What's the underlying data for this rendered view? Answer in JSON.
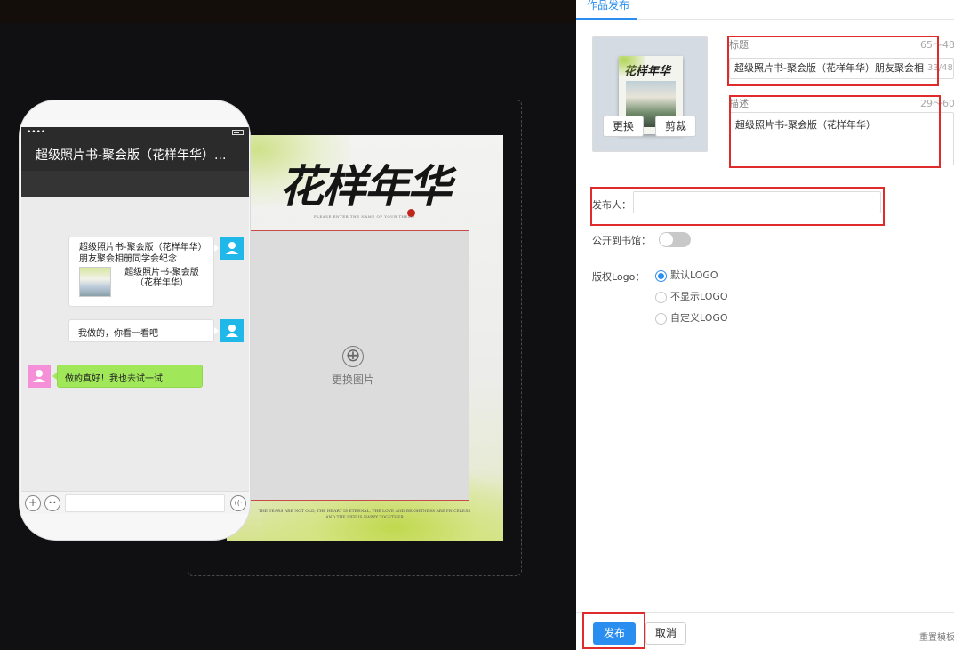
{
  "editor": {
    "canvas": {
      "hero_title": "花样年华",
      "hero_subtitle": "PLEASE ENTER THE NAME OF YOUR THEME",
      "replace_photo_label": "更换图片",
      "plus_glyph": "⊕",
      "footer_line1": "THE YEARS ARE NOT OLD, THE HEART IS ETERNAL, THE LOVE AND BRIGHTNESS ARE PRICELESS",
      "footer_line2": "AND THE LIFE IS HAPPY TOGETHER"
    }
  },
  "phone": {
    "signal_dots": "••••",
    "chat_title": "超级照片书-聚会版（花样年华）...",
    "messages": {
      "link_card": {
        "title": "超级照片书-聚会版（花样年华）朋友聚会相册同学会纪念",
        "desc": "超级照片书-聚会版（花样年华）"
      },
      "outgoing_text": "我做的，你看一看吧",
      "incoming_text": "做的真好！我也去试一试"
    },
    "input_bar": {
      "plus_glyph": "+",
      "emoji_glyph": "••",
      "voice_glyph": "((·"
    }
  },
  "panel": {
    "tab_label": "作品发布",
    "cover": {
      "book_title": "花样年华",
      "replace_label": "更换",
      "crop_label": "剪裁"
    },
    "title_field": {
      "label": "标题",
      "counter": "65～48",
      "value": "超级照片书-聚会版（花样年华）朋友聚会相",
      "count": "33/48"
    },
    "desc_field": {
      "label": "描述",
      "counter": "29～60",
      "value": "超级照片书-聚会版（花样年华）"
    },
    "publisher": {
      "label": "发布人：",
      "value": ""
    },
    "library": {
      "label": "公开到书馆：",
      "enabled": false
    },
    "logo": {
      "label": "版权Logo：",
      "options": [
        "默认LOGO",
        "不显示LOGO",
        "自定义LOGO"
      ],
      "selected": "默认LOGO"
    },
    "footer": {
      "publish_label": "发布",
      "cancel_label": "取消",
      "reset_label": "重置模板"
    }
  },
  "colors": {
    "accent": "#2a8ef0",
    "highlight": "#e02b2b",
    "incoming_bubble": "#a0e75a",
    "outgoing_avatar": "#1fb8e8",
    "incoming_avatar": "#f590d8"
  },
  "icons": [
    "plus-circle-icon",
    "user-avatar-icon",
    "battery-icon",
    "emoji-icon",
    "voice-icon"
  ]
}
